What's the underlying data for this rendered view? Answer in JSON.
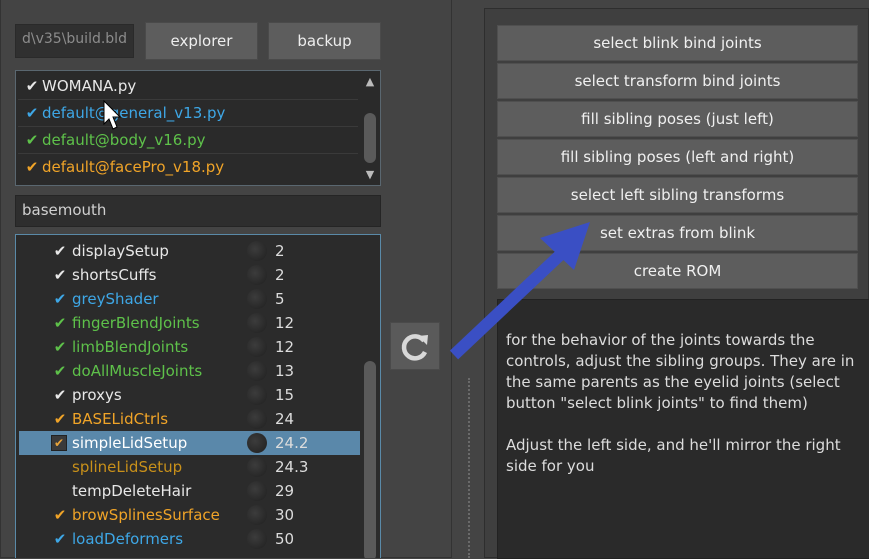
{
  "colors": {
    "white_check": "#e8e8e8",
    "blue": "#3ea7e6",
    "green": "#5ec14a",
    "orange": "#f0a428",
    "dark_orange": "#c8901a",
    "selection": "#5a88aa",
    "arrow": "#3a4fc4"
  },
  "toolbar": {
    "path_value": "d\\v35\\build.bld",
    "explorer_label": "explorer",
    "backup_label": "backup"
  },
  "files": [
    {
      "check": "✔",
      "label": "WOMANA.py",
      "color": "#e8e8e8"
    },
    {
      "check": "✔",
      "label": "default@general_v13.py",
      "color": "#3ea7e6"
    },
    {
      "check": "✔",
      "label": "default@body_v16.py",
      "color": "#5ec14a"
    },
    {
      "check": "✔",
      "label": "default@facePro_v18.py",
      "color": "#f0a428"
    }
  ],
  "filter": {
    "value": "basemouth"
  },
  "steps": [
    {
      "check": "✔",
      "name": "displaySetup",
      "num": "2",
      "color": "#e8e8e8",
      "check_color": "#e8e8e8"
    },
    {
      "check": "✔",
      "name": "shortsCuffs",
      "num": "2",
      "color": "#e8e8e8",
      "check_color": "#e8e8e8"
    },
    {
      "check": "✔",
      "name": "greyShader",
      "num": "5",
      "color": "#3ea7e6",
      "check_color": "#3ea7e6"
    },
    {
      "check": "✔",
      "name": "fingerBlendJoints",
      "num": "12",
      "color": "#5ec14a",
      "check_color": "#5ec14a"
    },
    {
      "check": "✔",
      "name": "limbBlendJoints",
      "num": "12",
      "color": "#5ec14a",
      "check_color": "#5ec14a"
    },
    {
      "check": "✔",
      "name": "doAllMuscleJoints",
      "num": "13",
      "color": "#5ec14a",
      "check_color": "#5ec14a"
    },
    {
      "check": "✔",
      "name": "proxys",
      "num": "15",
      "color": "#e8e8e8",
      "check_color": "#e8e8e8"
    },
    {
      "check": "✔",
      "name": "BASELidCtrls",
      "num": "24",
      "color": "#f0a428",
      "check_color": "#f0a428"
    },
    {
      "check": "✔",
      "name": "simpleLidSetup",
      "num": "24.2",
      "color": "#ffffff",
      "check_color": "#e9a43a",
      "selected": true
    },
    {
      "check": "",
      "name": "splineLidSetup",
      "num": "24.3",
      "color": "#c8901a",
      "check_color": "#c8901a"
    },
    {
      "check": "",
      "name": "tempDeleteHair",
      "num": "29",
      "color": "#e8e8e8",
      "check_color": "#e8e8e8"
    },
    {
      "check": "✔",
      "name": "browSplinesSurface",
      "num": "30",
      "color": "#f0a428",
      "check_color": "#f0a428"
    },
    {
      "check": "✔",
      "name": "loadDeformers",
      "num": "50",
      "color": "#3ea7e6",
      "check_color": "#3ea7e6"
    }
  ],
  "actions": [
    "select blink bind joints",
    "select transform bind joints",
    "fill sibling poses (just left)",
    "fill sibling poses (left and right)",
    "select left sibling transforms",
    "set extras from blink",
    "create ROM"
  ],
  "description": {
    "paragraph1": "for the behavior of the joints towards the controls, adjust the sibling groups. They are in the same parents as the eyelid joints (select button \"select blink joints\" to find them)",
    "paragraph2": "Adjust the left side, and he'll mirror the right side for you"
  }
}
